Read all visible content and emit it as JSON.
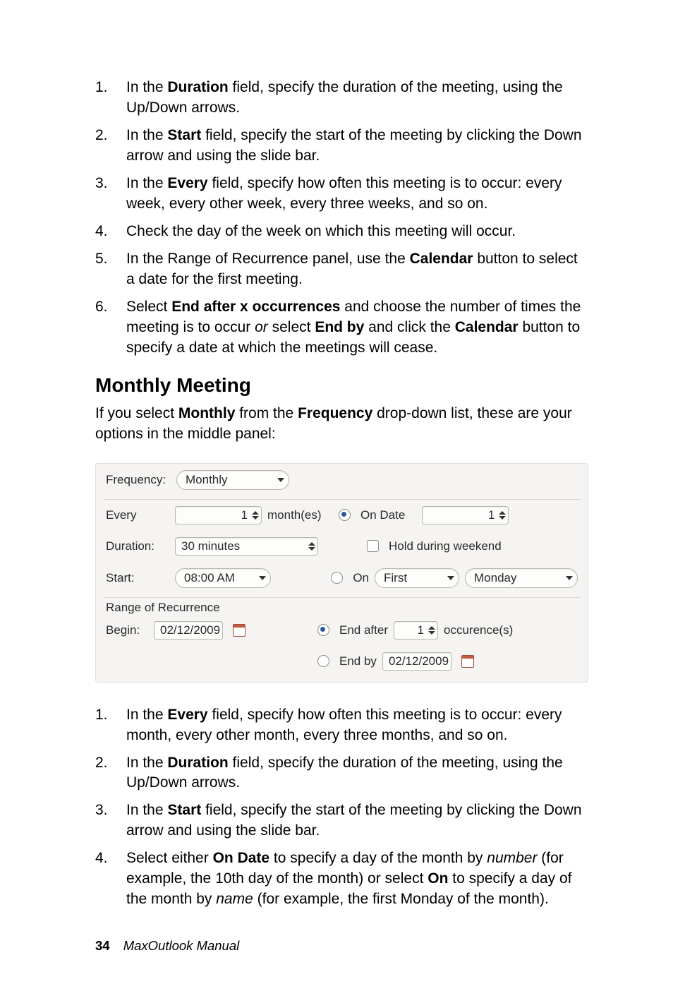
{
  "list1": {
    "items": [
      {
        "n": "1.",
        "pre": "In the ",
        "b1": "Duration",
        "post": " field, specify the duration of the meeting, using the Up/Down arrows."
      },
      {
        "n": "2.",
        "pre": "In the ",
        "b1": "Start",
        "post": " field, specify the start of the meeting by clicking the Down arrow and using the slide bar."
      },
      {
        "n": "3.",
        "pre": "In the ",
        "b1": "Every",
        "post": " field, specify how often this meeting is to occur: every week, every other week, every three weeks, and so on."
      },
      {
        "n": "4.",
        "pre": "Check the day of the week on which this meeting will occur.",
        "b1": "",
        "post": ""
      },
      {
        "n": "5.",
        "pre": "In the Range of Recurrence panel, use the ",
        "b1": "Calendar",
        "post": " button to select a date for the first meeting."
      }
    ],
    "item6": {
      "n": "6.",
      "t1": "Select ",
      "b1": "End after x occurrences",
      "t2": " and choose the number of times the meeting is to occur ",
      "i1": "or",
      "t3": " select ",
      "b2": "End by",
      "t4": " and click the ",
      "b3": "Calendar",
      "t5": " button to specify a date at which the meetings will cease."
    }
  },
  "heading": "Monthly Meeting",
  "intro": {
    "t1": "If you select ",
    "b1": "Monthly",
    "t2": " from the ",
    "b2": "Frequency",
    "t3": " drop-down list, these are your options in the middle panel:"
  },
  "dlg": {
    "freq_label": "Frequency:",
    "freq_value": "Monthly",
    "every_label": "Every",
    "every_value": "1",
    "every_unit": "month(es)",
    "ondate_label": "On Date",
    "ondate_value": "1",
    "dur_label": "Duration:",
    "dur_value": "30 minutes",
    "hold_label": "Hold during weekend",
    "start_label": "Start:",
    "start_value": "08:00 AM",
    "on_label": "On",
    "on_ord": "First",
    "on_day": "Monday",
    "range_title": "Range of Recurrence",
    "begin_label": "Begin:",
    "begin_value": "02/12/2009",
    "endafter_label": "End after",
    "endafter_value": "1",
    "endafter_unit": "occurence(s)",
    "endby_label": "End by",
    "endby_value": "02/12/2009"
  },
  "list2": {
    "items": [
      {
        "n": "1.",
        "pre": "In the ",
        "b1": "Every",
        "post": " field, specify how often this meeting is to occur: every month, every other month, every three months, and so on."
      },
      {
        "n": "2.",
        "pre": "In the ",
        "b1": "Duration",
        "post": " field, specify the duration of the meeting, using the Up/Down arrows."
      },
      {
        "n": "3.",
        "pre": "In the ",
        "b1": "Start",
        "post": " field, specify the start of the meeting by clicking the Down arrow and using the slide bar."
      }
    ],
    "item4": {
      "n": "4.",
      "t1": "Select either ",
      "b1": "On Date",
      "t2": " to specify a day of the month by ",
      "i1": "number",
      "t3": " (for example, the 10th day of the month) or select ",
      "b2": "On",
      "t4": " to specify a day of the month by ",
      "i2": "name",
      "t5": " (for example, the first Monday of the month)."
    }
  },
  "footer": {
    "page": "34",
    "title": "MaxOutlook Manual"
  }
}
